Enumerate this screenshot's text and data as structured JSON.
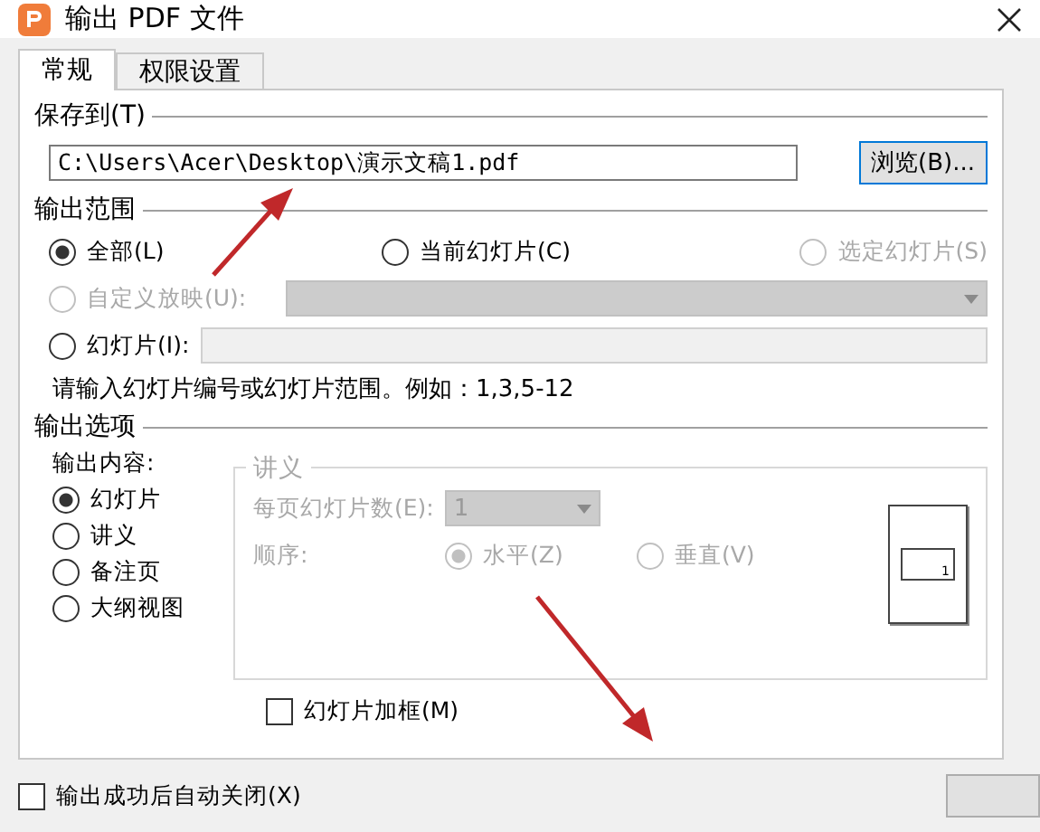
{
  "window": {
    "title": "输出 PDF 文件"
  },
  "tabs": [
    {
      "label": "常规",
      "selected": true
    },
    {
      "label": "权限设置",
      "selected": false
    }
  ],
  "save_to": {
    "heading": "保存到(T)",
    "path": "C:\\Users\\Acer\\Desktop\\演示文稿1.pdf",
    "browse_button": "浏览(B)..."
  },
  "output_range": {
    "heading": "输出范围",
    "options": [
      {
        "label": "全部(L)",
        "selected": true,
        "disabled": false
      },
      {
        "label": "当前幻灯片(C)",
        "selected": false,
        "disabled": false
      },
      {
        "label": "选定幻灯片(S)",
        "selected": false,
        "disabled": true
      }
    ],
    "custom_show": {
      "label": "自定义放映(U):",
      "selected": false,
      "disabled": true
    },
    "slides": {
      "label": "幻灯片(I):",
      "selected": false
    },
    "hint": "请输入幻灯片编号或幻灯片范围。例如：1,3,5-12"
  },
  "output_options": {
    "heading": "输出选项",
    "content_label": "输出内容:",
    "content_options": [
      {
        "label": "幻灯片",
        "selected": true
      },
      {
        "label": "讲义",
        "selected": false
      },
      {
        "label": "备注页",
        "selected": false
      },
      {
        "label": "大纲视图",
        "selected": false
      }
    ],
    "handout": {
      "heading": "讲义",
      "disabled": true,
      "per_page_label": "每页幻灯片数(E):",
      "per_page_value": "1",
      "order_label": "顺序:",
      "order_options": [
        {
          "label": "水平(Z)",
          "selected": true
        },
        {
          "label": "垂直(V)",
          "selected": false
        }
      ],
      "preview_number": "1"
    },
    "frame_checkbox": {
      "label": "幻灯片加框(M)",
      "checked": false
    }
  },
  "auto_close": {
    "label": "输出成功后自动关闭(X)",
    "checked": false
  }
}
